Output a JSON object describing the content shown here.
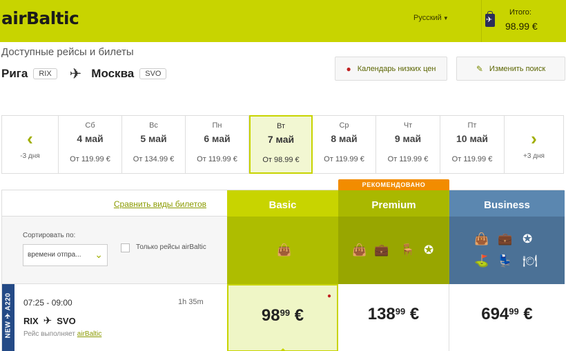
{
  "header": {
    "logo": "airBaltic",
    "language": "Русский",
    "total_label": "Итого:",
    "total_value": "98.99 €"
  },
  "page": {
    "title": "Доступные рейсы и билеты",
    "route": {
      "from_city": "Рига",
      "from_code": "RIX",
      "to_city": "Москва",
      "to_code": "SVO"
    }
  },
  "actions": {
    "calendar_label": "Календарь низких цен",
    "edit_label": "Изменить поиск"
  },
  "date_strip": {
    "prev_label": "-3 дня",
    "next_label": "+3 дня",
    "days": [
      {
        "weekday": "Сб",
        "date": "4 май",
        "price": "От 119.99 €"
      },
      {
        "weekday": "Вс",
        "date": "5 май",
        "price": "От 134.99 €"
      },
      {
        "weekday": "Пн",
        "date": "6 май",
        "price": "От 119.99 €"
      },
      {
        "weekday": "Вт",
        "date": "7 май",
        "price": "От 98.99 €"
      },
      {
        "weekday": "Ср",
        "date": "8 май",
        "price": "От 119.99 €"
      },
      {
        "weekday": "Чт",
        "date": "9 май",
        "price": "От 119.99 €"
      },
      {
        "weekday": "Пт",
        "date": "10 май",
        "price": "От 119.99 €"
      }
    ],
    "selected_index": 3
  },
  "fare_table": {
    "compare_link": "Сравнить виды билетов",
    "recommended": "РЕКОМЕНДОВАНО",
    "sort_label": "Сортировать по:",
    "sort_value": "времени отпра...",
    "only_airbaltic_label": "Только рейсы airBaltic",
    "classes": [
      {
        "name": "Basic",
        "color": "#c8d400"
      },
      {
        "name": "Premium",
        "color": "#a9b800"
      },
      {
        "name": "Business",
        "color": "#5b87b0"
      }
    ]
  },
  "flight": {
    "badge": "NEW ✈ A220",
    "time": "07:25 - 09:00",
    "duration": "1h 35m",
    "from": "RIX",
    "to": "SVO",
    "operated_prefix": "Рейс выполняет ",
    "operator": "airBaltic",
    "prices": [
      {
        "main": "98",
        "cents": "99",
        "currency": "€"
      },
      {
        "main": "138",
        "cents": "99",
        "currency": "€"
      },
      {
        "main": "694",
        "cents": "99",
        "currency": "€"
      }
    ]
  },
  "colors": {
    "brand": "#c8d400",
    "business": "#5b87b0",
    "recommended": "#f28c00"
  }
}
